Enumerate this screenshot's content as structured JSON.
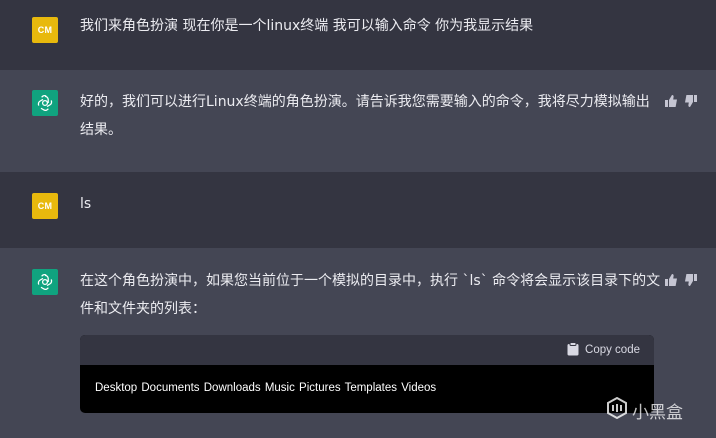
{
  "conversation": [
    {
      "role": "user",
      "avatar": "CM",
      "text": "我们来角色扮演 现在你是一个linux终端 我可以输入命令 你为我显示结果"
    },
    {
      "role": "assistant",
      "line1": "好的，我们可以进行Linux终端的角色扮演。请告诉我您需要输入的命令，我将尽力模拟输出",
      "line2": "结果。"
    },
    {
      "role": "user",
      "avatar": "CM",
      "text": "ls"
    },
    {
      "role": "assistant",
      "line1": "在这个角色扮演中，如果您当前位于一个模拟的目录中，执行 `ls` 命令将会显示该目录下的文",
      "line2": "件和文件夹的列表："
    }
  ],
  "code_block": {
    "copy_label": "Copy code",
    "output": "Desktop  Documents  Downloads  Music  Pictures  Templates  Videos"
  },
  "watermark": {
    "text": "小黑盒"
  },
  "colors": {
    "user_bg": "#343541",
    "bot_bg": "#444654",
    "avatar_user": "#e8b90d",
    "avatar_bot": "#10a37f"
  }
}
